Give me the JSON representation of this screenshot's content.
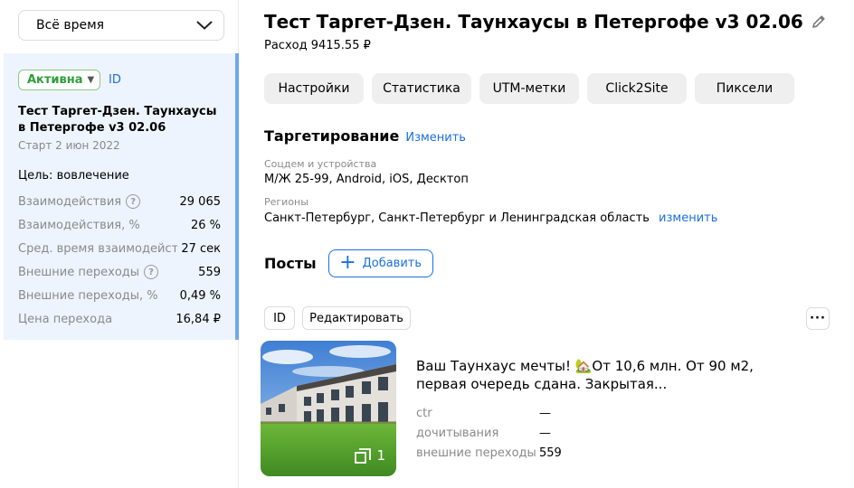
{
  "sidebar": {
    "period": "Всё время",
    "card": {
      "status": "Активна",
      "id_link": "ID",
      "title": "Тест Таргет-Дзен. Таунхаусы в Петергофе v3 02.06",
      "start": "Старт 2 июн 2022",
      "goal": "Цель: вовлечение",
      "metrics": [
        {
          "name": "Взаимодействия",
          "value": "29 065",
          "help": true
        },
        {
          "name": "Взаимодействия, %",
          "value": "26 %",
          "help": false
        },
        {
          "name": "Сред. время взаимодейст",
          "value": "27 сек",
          "help": false
        },
        {
          "name": "Внешние переходы",
          "value": "559",
          "help": true
        },
        {
          "name": "Внешние переходы, %",
          "value": "0,49 %",
          "help": false
        },
        {
          "name": "Цена перехода",
          "value": "16,84 ₽",
          "help": false
        }
      ]
    }
  },
  "main": {
    "title": "Тест Таргет-Дзен. Таунхаусы в Петергофе v3 02.06",
    "spend": "Расход 9415.55 ₽",
    "tabs": [
      {
        "label": "Настройки"
      },
      {
        "label": "Статистика"
      },
      {
        "label": "UTM-метки"
      },
      {
        "label": "Click2Site"
      },
      {
        "label": "Пиксели"
      }
    ],
    "targeting": {
      "title": "Таргетирование",
      "edit": "Изменить",
      "socdem_label": "Соцдем и устройства",
      "socdem_value": "М/Ж 25-99, Android, iOS, Десктоп",
      "regions_label": "Регионы",
      "regions_value": "Санкт-Петербург, Санкт-Петербург и Ленинградская область",
      "regions_edit": "изменить"
    },
    "posts": {
      "title": "Посты",
      "add": "Добавить",
      "id_chip": "ID",
      "edit_chip": "Редактировать",
      "more": "···",
      "item": {
        "text": "Ваш Таунхаус мечты! 🏡От 10,6 млн. От 90 м2, первая очередь сдана. Закрытая...",
        "image_count": "1",
        "stats": [
          {
            "name": "ctr",
            "value": "—"
          },
          {
            "name": "дочитывания",
            "value": "—"
          },
          {
            "name": "внешние переходы",
            "value": "559"
          }
        ]
      }
    }
  },
  "colors": {
    "accent": "#1a6fe0",
    "active": "#2f9e3b",
    "card_bg": "#eef4fd",
    "tab_bg": "#efefef"
  }
}
